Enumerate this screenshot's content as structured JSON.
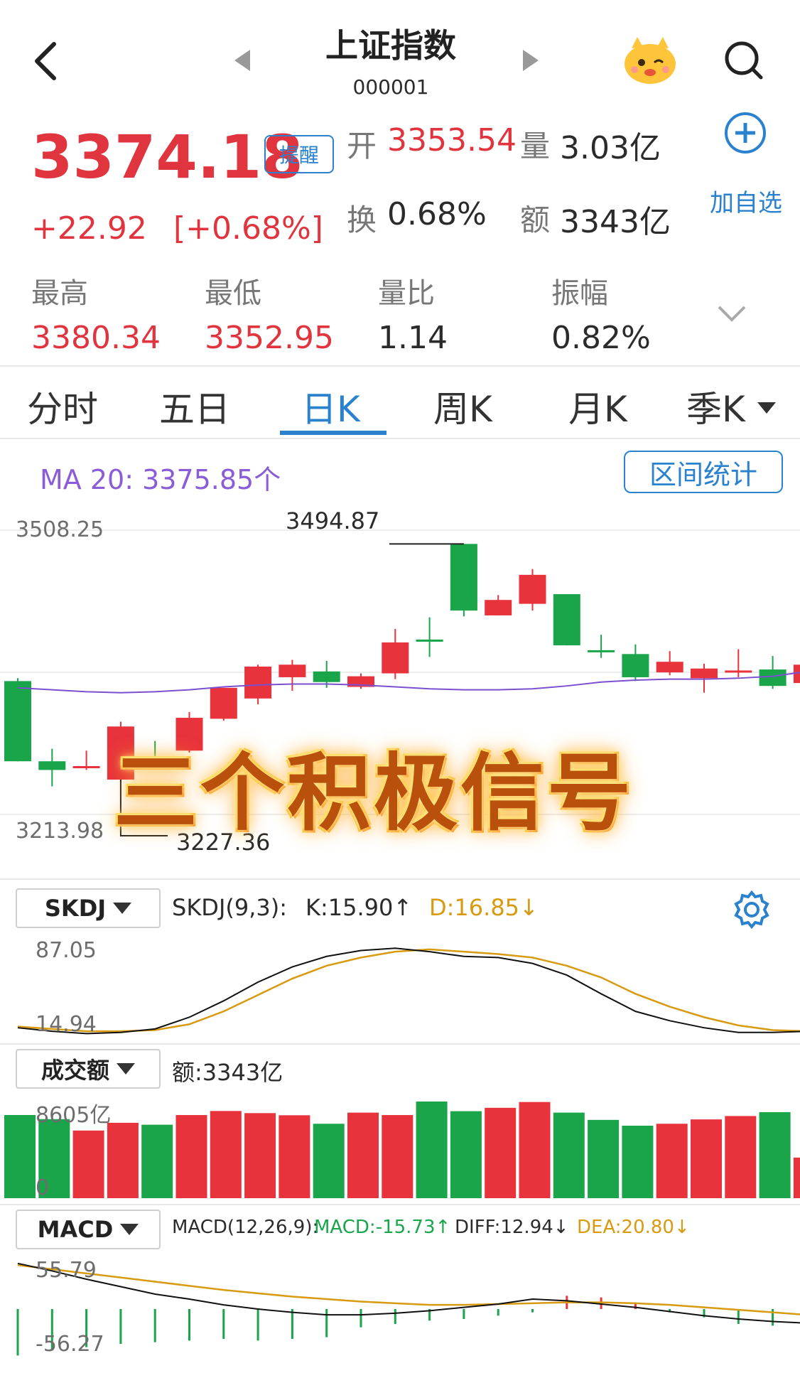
{
  "header": {
    "title": "上证指数",
    "code": "000001"
  },
  "quote": {
    "price": "3374.18",
    "alert_label": "提醒",
    "change": "+22.92",
    "change_pct": "[+0.68%]",
    "open_label": "开",
    "open": "3353.54",
    "volume_label": "量",
    "volume": "3.03亿",
    "turnover_label": "换",
    "turnover": "0.68%",
    "amount_label": "额",
    "amount": "3343亿",
    "add_watch_label": "加自选",
    "high_label": "最高",
    "high": "3380.34",
    "low_label": "最低",
    "low": "3352.95",
    "vol_ratio_label": "量比",
    "vol_ratio": "1.14",
    "amplitude_label": "振幅",
    "amplitude": "0.82%"
  },
  "tabs": [
    "分时",
    "五日",
    "日K",
    "周K",
    "月K",
    "季K"
  ],
  "active_tab": 2,
  "main_chart": {
    "ma_label": "MA 20: 3375.85个",
    "range_button": "区间统计",
    "y_top": "3508.25",
    "y_bottom": "3213.98",
    "max_label": "3494.87",
    "min_label": "3227.36",
    "banner": "三个积极信号"
  },
  "skdj": {
    "selector": "SKDJ",
    "params": "SKDJ(9,3):",
    "k": "K:15.90↑",
    "d": "D:16.85↓",
    "y_top": "87.05",
    "y_bottom": "14.94",
    "colors": {
      "k": "#111111",
      "d": "#d89a10"
    }
  },
  "volume_panel": {
    "selector": "成交额",
    "amount": "额:3343亿",
    "y_top": "8605亿",
    "y_bottom": "0"
  },
  "macd": {
    "selector": "MACD",
    "params": "MACD(12,26,9):",
    "macd": "MACD:-15.73↑",
    "diff": "DIFF:12.94↓",
    "dea": "DEA:20.80↓",
    "y_top": "55.79",
    "y_bottom": "-56.27"
  },
  "colors": {
    "up": "#e8323c",
    "down": "#1aa54a",
    "accent": "#2a82cf",
    "ma": "#7b4fd0"
  },
  "chart_data": {
    "type": "candlestick",
    "ylim": [
      3213.98,
      3508.25
    ],
    "candles": [
      {
        "o": 3352,
        "c": 3269,
        "h": 3355,
        "l": 3269,
        "up": false
      },
      {
        "o": 3269,
        "c": 3260,
        "h": 3282,
        "l": 3243,
        "up": false
      },
      {
        "o": 3264,
        "c": 3264,
        "h": 3280,
        "l": 3260,
        "up": true
      },
      {
        "o": 3250,
        "c": 3305,
        "h": 3310,
        "l": 3248,
        "up": true
      },
      {
        "o": 3270,
        "c": 3272,
        "h": 3290,
        "l": 3262,
        "up": false
      },
      {
        "o": 3280,
        "c": 3314,
        "h": 3320,
        "l": 3278,
        "up": true
      },
      {
        "o": 3313,
        "c": 3345,
        "h": 3345,
        "l": 3311,
        "up": true
      },
      {
        "o": 3334,
        "c": 3367,
        "h": 3369,
        "l": 3328,
        "up": true
      },
      {
        "o": 3356,
        "c": 3369,
        "h": 3374,
        "l": 3342,
        "up": true
      },
      {
        "o": 3362,
        "c": 3351,
        "h": 3373,
        "l": 3345,
        "up": false
      },
      {
        "o": 3346,
        "c": 3357,
        "h": 3360,
        "l": 3344,
        "up": true
      },
      {
        "o": 3360,
        "c": 3392,
        "h": 3406,
        "l": 3354,
        "up": true
      },
      {
        "o": 3395,
        "c": 3395,
        "h": 3418,
        "l": 3377,
        "up": false
      },
      {
        "o": 3494,
        "c": 3425,
        "h": 3494,
        "l": 3419,
        "up": false
      },
      {
        "o": 3420,
        "c": 3436,
        "h": 3441,
        "l": 3420,
        "up": true
      },
      {
        "o": 3432,
        "c": 3462,
        "h": 3468,
        "l": 3425,
        "up": true
      },
      {
        "o": 3442,
        "c": 3389,
        "h": 3442,
        "l": 3389,
        "up": false
      },
      {
        "o": 3384,
        "c": 3384,
        "h": 3400,
        "l": 3376,
        "up": false
      },
      {
        "o": 3380,
        "c": 3356,
        "h": 3390,
        "l": 3352,
        "up": false
      },
      {
        "o": 3361,
        "c": 3372,
        "h": 3383,
        "l": 3358,
        "up": true
      },
      {
        "o": 3355,
        "c": 3365,
        "h": 3370,
        "l": 3340,
        "up": true
      },
      {
        "o": 3361,
        "c": 3363,
        "h": 3385,
        "l": 3356,
        "up": true
      },
      {
        "o": 3364,
        "c": 3347,
        "h": 3378,
        "l": 3344,
        "up": false
      },
      {
        "o": 3350,
        "c": 3369,
        "h": 3372,
        "l": 3348,
        "up": true
      }
    ],
    "ma20": [
      3345,
      3343,
      3341,
      3340,
      3341,
      3343,
      3346,
      3348,
      3349,
      3349,
      3348,
      3346,
      3344,
      3343,
      3343,
      3344,
      3347,
      3351,
      3353,
      3354,
      3354,
      3355,
      3357,
      3362
    ],
    "skdj_k": [
      19,
      16,
      14,
      15,
      18,
      28,
      42,
      58,
      71,
      80,
      85,
      87,
      84,
      80,
      79,
      74,
      64,
      48,
      33,
      25,
      19,
      15,
      15,
      16
    ],
    "skdj_d": [
      20,
      18,
      16,
      16,
      17,
      22,
      33,
      47,
      61,
      72,
      79,
      84,
      86,
      84,
      82,
      79,
      72,
      62,
      48,
      37,
      28,
      21,
      17,
      16
    ],
    "amount": [
      8605,
      8180,
      7000,
      7800,
      7600,
      8600,
      9020,
      8800,
      8580,
      7700,
      8850,
      8600,
      10000,
      9000,
      9350,
      9950,
      8850,
      8100,
      7500,
      7700,
      8150,
      8500,
      8900,
      4200
    ],
    "macd_diff": [
      55,
      46,
      36,
      27,
      18,
      12,
      5,
      0,
      -4,
      -7,
      -7,
      -5,
      -2,
      2,
      6,
      12,
      10,
      6,
      2,
      -3,
      -8,
      -12,
      -15,
      -17
    ],
    "macd_dea": [
      53,
      48,
      43,
      38,
      33,
      28,
      23,
      19,
      15,
      12,
      9,
      7,
      5,
      5,
      6,
      7,
      8,
      8,
      7,
      5,
      2,
      -1,
      -4,
      -7
    ],
    "macd_bar": [
      -56,
      -50,
      -46,
      -42,
      -40,
      -38,
      -36,
      -38,
      -36,
      -34,
      -22,
      -18,
      -14,
      -12,
      -8,
      -4,
      16,
      14,
      8,
      -4,
      -10,
      -18,
      -20,
      -22
    ]
  }
}
